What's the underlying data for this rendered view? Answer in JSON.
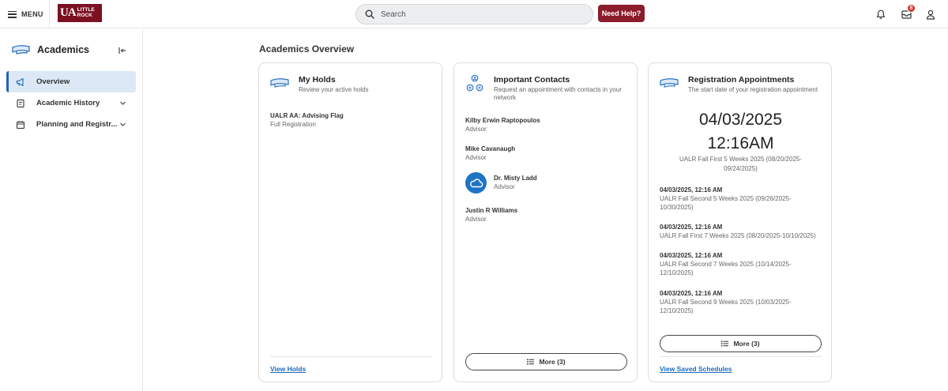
{
  "header": {
    "menu_label": "MENU",
    "logo": {
      "ua": "UA",
      "line1": "LITTLE",
      "line2": "ROCK"
    },
    "search_placeholder": "Search",
    "help_label": "Need Help?",
    "inbox_badge": "8",
    "icons": [
      "hamburger-icon",
      "search-icon",
      "bell-icon",
      "inbox-icon",
      "user-icon"
    ]
  },
  "sidebar": {
    "title": "Academics",
    "items": [
      {
        "label": "Overview",
        "active": true,
        "icon": "megaphone-icon"
      },
      {
        "label": "Academic History",
        "active": false,
        "icon": "document-icon"
      },
      {
        "label": "Planning and Registr...",
        "active": false,
        "icon": "calendar-icon"
      }
    ]
  },
  "main": {
    "title": "Academics Overview",
    "holds": {
      "title": "My Holds",
      "subtitle": "Review your active holds",
      "items": [
        {
          "title": "UALR AA: Advising Flag",
          "subtitle": "Full Registration"
        }
      ],
      "link": "View Holds"
    },
    "contacts": {
      "title": "Important Contacts",
      "subtitle": "Request an appointment with contacts in your network",
      "items": [
        {
          "name": "Kilby Erwin Raptopoulos",
          "role": "Advisor"
        },
        {
          "name": "Mike Cavanaugh",
          "role": "Advisor"
        },
        {
          "name": "Dr. Misty Ladd",
          "role": "Advisor"
        },
        {
          "name": "Justin R Williams",
          "role": "Advisor"
        }
      ],
      "more": "More (3)"
    },
    "registration": {
      "title": "Registration Appointments",
      "subtitle": "The start date of your registration appointment",
      "date": "04/03/2025",
      "time": "12:16AM",
      "primary_desc": "UALR Fall First 5 Weeks 2025 (08/20/2025-09/24/2025)",
      "items": [
        {
          "when": "04/03/2025, 12:16 AM",
          "desc": "UALR Fall Second 5 Weeks 2025 (09/26/2025-10/30/2025)"
        },
        {
          "when": "04/03/2025, 12:16 AM",
          "desc": "UALR Fall First 7 Weeks 2025 (08/20/2025-10/10/2025)"
        },
        {
          "when": "04/03/2025, 12:16 AM",
          "desc": "UALR Fall Second 7 Weeks 2025 (10/14/2025-12/10/2025)"
        },
        {
          "when": "04/03/2025, 12:16 AM",
          "desc": "UALR Fall Second 9 Weeks 2025 (10/03/2025-12/10/2025)"
        }
      ],
      "more": "More (3)",
      "link": "View Saved Schedules"
    }
  },
  "colors": {
    "brand": "#7b1120",
    "help_button": "#8c1b2b",
    "link": "#1a6bbf",
    "active_nav_bg": "#dce8f6",
    "active_nav_bar": "#2563b6",
    "badge": "#d93025"
  }
}
